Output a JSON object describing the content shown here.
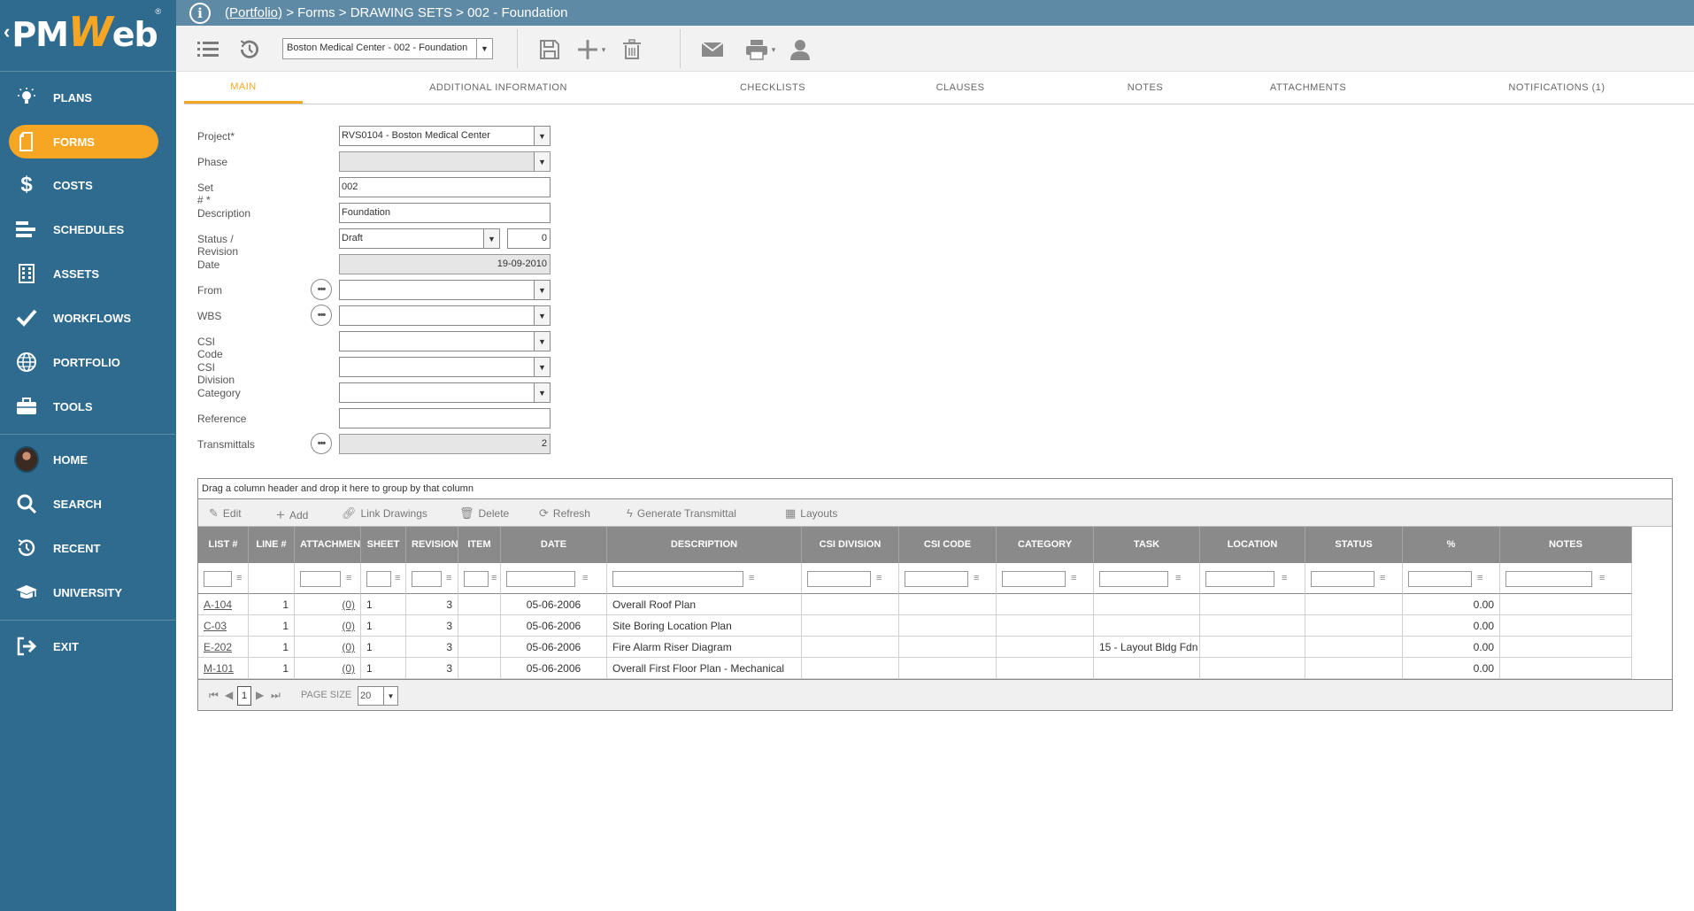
{
  "app": {
    "logo_text_pre": "PM",
    "logo_text_w": "W",
    "logo_text_post": "eb",
    "logo_reg": "®",
    "brand_color": "#f6a623",
    "sidebar_color": "#2e6b8e"
  },
  "sidebar": {
    "items": [
      {
        "label": "PLANS",
        "icon": "lightbulb-icon"
      },
      {
        "label": "FORMS",
        "icon": "document-icon",
        "active": true
      },
      {
        "label": "COSTS",
        "icon": "dollar-icon"
      },
      {
        "label": "SCHEDULES",
        "icon": "gantt-icon"
      },
      {
        "label": "ASSETS",
        "icon": "building-icon"
      },
      {
        "label": "WORKFLOWS",
        "icon": "checkmark-icon"
      },
      {
        "label": "PORTFOLIO",
        "icon": "globe-icon"
      },
      {
        "label": "TOOLS",
        "icon": "briefcase-icon"
      },
      {
        "label": "HOME",
        "icon": "avatar"
      },
      {
        "label": "SEARCH",
        "icon": "search-icon"
      },
      {
        "label": "RECENT",
        "icon": "history-icon"
      },
      {
        "label": "UNIVERSITY",
        "icon": "graduation-cap-icon"
      },
      {
        "label": "EXIT",
        "icon": "exit-icon"
      }
    ]
  },
  "breadcrumb": {
    "portfolio": "(Portfolio)",
    "rest": " > Forms > DRAWING SETS > 002 - Foundation"
  },
  "toolbar": {
    "record_select": "Boston Medical Center - 002 - Foundation"
  },
  "tabs": [
    {
      "label": "MAIN",
      "active": true
    },
    {
      "label": "ADDITIONAL INFORMATION"
    },
    {
      "label": "CHECKLISTS"
    },
    {
      "label": "CLAUSES"
    },
    {
      "label": "NOTES"
    },
    {
      "label": "ATTACHMENTS"
    },
    {
      "label": "NOTIFICATIONS (1)"
    }
  ],
  "form": {
    "project_label": "Project*",
    "project_value": "RVS0104 - Boston Medical Center",
    "phase_label": "Phase",
    "phase_value": "",
    "set_label": "Set # *",
    "set_value": "002",
    "description_label": "Description",
    "description_value": "Foundation",
    "status_label": "Status / Revision",
    "status_value": "Draft",
    "revision_value": "0",
    "date_label": "Date",
    "date_value": "19-09-2010",
    "from_label": "From",
    "wbs_label": "WBS",
    "csi_code_label": "CSI Code",
    "csi_division_label": "CSI Division",
    "category_label": "Category",
    "reference_label": "Reference",
    "transmittals_label": "Transmittals",
    "transmittals_value": "2",
    "dots": "•••"
  },
  "grid": {
    "group_hint": "Drag a column header and drop it here to group by that column",
    "tools": {
      "edit": "Edit",
      "add": "Add",
      "link": "Link Drawings",
      "delete": "Delete",
      "refresh": "Refresh",
      "transmittal": "Generate Transmittal",
      "layouts": "Layouts"
    },
    "columns": [
      "LIST #",
      "LINE #",
      "ATTACHMENTS",
      "SHEET",
      "REVISION",
      "ITEM",
      "DATE",
      "DESCRIPTION",
      "CSI DIVISION",
      "CSI CODE",
      "CATEGORY",
      "TASK",
      "LOCATION",
      "STATUS",
      "%",
      "NOTES"
    ],
    "rows": [
      {
        "list": "A-104",
        "line": "1",
        "att": "(0)",
        "sheet": "1",
        "rev": "3",
        "item": "",
        "date": "05-06-2006",
        "desc": "Overall Roof Plan",
        "csidiv": "",
        "csicode": "",
        "cat": "",
        "task": "",
        "loc": "",
        "status": "",
        "pct": "0.00",
        "notes": ""
      },
      {
        "list": "C-03",
        "line": "1",
        "att": "(0)",
        "sheet": "1",
        "rev": "3",
        "item": "",
        "date": "05-06-2006",
        "desc": "Site Boring Location Plan",
        "csidiv": "",
        "csicode": "",
        "cat": "",
        "task": "",
        "loc": "",
        "status": "",
        "pct": "0.00",
        "notes": ""
      },
      {
        "list": "E-202",
        "line": "1",
        "att": "(0)",
        "sheet": "1",
        "rev": "3",
        "item": "",
        "date": "05-06-2006",
        "desc": "Fire Alarm Riser Diagram",
        "csidiv": "",
        "csicode": "",
        "cat": "",
        "task": "15 - Layout Bldg Fdn",
        "loc": "",
        "status": "",
        "pct": "0.00",
        "notes": ""
      },
      {
        "list": "M-101",
        "line": "1",
        "att": "(0)",
        "sheet": "1",
        "rev": "3",
        "item": "",
        "date": "05-06-2006",
        "desc": "Overall First Floor Plan - Mechanical",
        "csidiv": "",
        "csicode": "",
        "cat": "",
        "task": "",
        "loc": "",
        "status": "",
        "pct": "0.00",
        "notes": ""
      }
    ],
    "pager": {
      "page": "1",
      "size_label": "PAGE SIZE",
      "size_value": "20"
    }
  }
}
